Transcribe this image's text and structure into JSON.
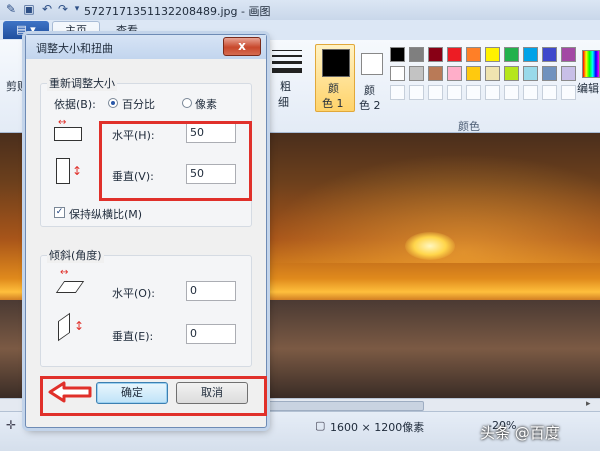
{
  "window": {
    "title": "5727171351132208489.jpg - 画图"
  },
  "tabs": {
    "file_label": "▤ ▾",
    "home_label": "主页",
    "view_label": "查看"
  },
  "ribbon": {
    "clipboard_label": "剪贴",
    "size_label": "粗",
    "size_label2": "细",
    "color1_label": "颜",
    "color1_label2": "色 1",
    "color2_label": "颜",
    "color2_label2": "色 2",
    "colors_group_label": "颜色",
    "edit_colors_label": "编辑",
    "palette_row1": [
      "#000000",
      "#7f7f7f",
      "#880015",
      "#ed1c24",
      "#ff7f27",
      "#fff200",
      "#22b14c",
      "#00a2e8",
      "#3f48cc",
      "#a349a4"
    ],
    "palette_row2": [
      "#ffffff",
      "#c3c3c3",
      "#b97a57",
      "#ffaec9",
      "#ffc90e",
      "#efe4b0",
      "#b5e61d",
      "#99d9ea",
      "#7092be",
      "#c8bfe7"
    ]
  },
  "dialog": {
    "title": "调整大小和扭曲",
    "close_label": "x",
    "resize_group": "重新调整大小",
    "by_label": "依据(B):",
    "percent_label": "百分比",
    "pixels_label": "像素",
    "horizontal_label": "水平(H):",
    "horizontal_value": "50",
    "vertical_label": "垂直(V):",
    "vertical_value": "50",
    "keep_ratio_label": "保持纵横比(M)",
    "skew_group": "倾斜(角度)",
    "skew_h_label": "水平(O):",
    "skew_h_value": "0",
    "skew_v_label": "垂直(E):",
    "skew_v_value": "0",
    "ok_label": "确定",
    "cancel_label": "取消"
  },
  "status": {
    "dimensions": "1600 × 1200像素",
    "zoom": "-20%"
  },
  "watermark": "头条 @百度"
}
